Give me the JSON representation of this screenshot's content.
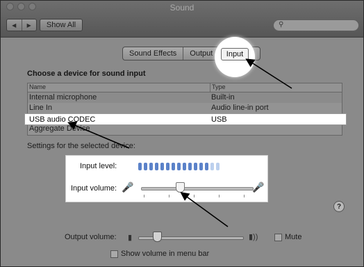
{
  "window": {
    "title": "Sound"
  },
  "toolbar": {
    "back_label": "◀",
    "forward_label": "▶",
    "show_all_label": "Show All",
    "search_placeholder": ""
  },
  "tabs": [
    {
      "label": "Sound Effects"
    },
    {
      "label": "Output"
    },
    {
      "label": "Input",
      "selected": true
    }
  ],
  "input": {
    "heading": "Choose a device for sound input",
    "columns": {
      "name": "Name",
      "type": "Type"
    },
    "devices": [
      {
        "name": "Internal microphone",
        "type": "Built-in"
      },
      {
        "name": "Line In",
        "type": "Audio line-in port"
      },
      {
        "name": "USB audio CODEC",
        "type": "USB",
        "selected": true
      },
      {
        "name": "Aggregate Device",
        "type": ""
      }
    ],
    "settings_label": "Settings for the selected device:",
    "input_level_label": "Input level:",
    "input_level": {
      "active_segments": 13,
      "total_segments": 15
    },
    "input_volume_label": "Input volume:",
    "input_volume_value": 0.35
  },
  "output": {
    "volume_label": "Output volume:",
    "volume_value": 0.18,
    "mute_label": "Mute",
    "mute_checked": false,
    "show_volume_label": "Show volume in menu bar",
    "show_volume_checked": false
  },
  "help": {
    "label": "?"
  },
  "colors": {
    "meter_active": "#5b82c9",
    "meter_inactive": "#bcd0ee",
    "highlight": "#ffffff"
  }
}
